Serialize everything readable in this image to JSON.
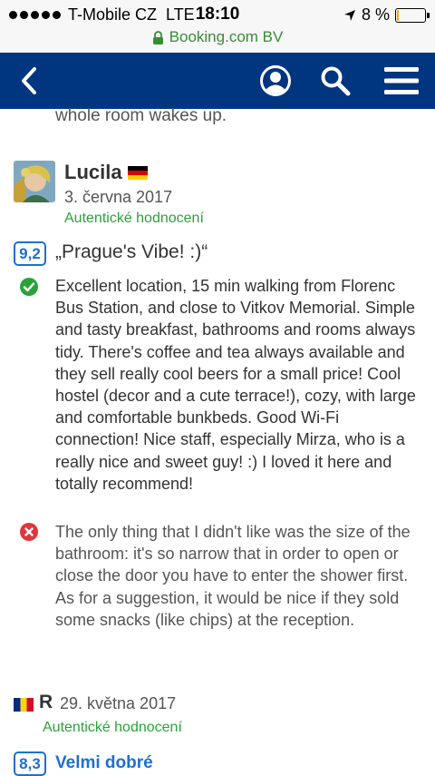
{
  "status_bar": {
    "carrier": "T-Mobile CZ",
    "network": "LTE",
    "time": "18:10",
    "battery_text": "8 %",
    "battery_fraction": 0.08,
    "battery_color": "#f5a800"
  },
  "url_bar": {
    "domain": "Booking.com BV",
    "lock_icon": "lock-icon"
  },
  "nav": {
    "background": "#003580",
    "icons": [
      "back-arrow-icon",
      "account-icon",
      "search-icon",
      "menu-icon"
    ]
  },
  "previous_review_tail": "whole room wakes up.",
  "review1": {
    "reviewer": "Lucila",
    "country_flag": "flag-germany-icon",
    "date": "3. června 2017",
    "verified": "Autentické hodnocení",
    "score": "9,2",
    "title": "„Prague's Vibe! :)“",
    "positive_icon": "check-circle-icon",
    "positive": "Excellent location, 15 min walking from Florenc Bus Station, and close to Vitkov Memorial. Simple and tasty breakfast, bathrooms and rooms always tidy. There's coffee and tea always available and they sell really cool beers for a small price! Cool hostel (decor and a cute terrace!), cozy, with large and comfortable bunkbeds. Good Wi-Fi connection! Nice staff, especially Mirza, who is a really nice and sweet guy! :) I loved it here and totally recommend!",
    "negative_icon": "x-circle-icon",
    "negative": "The only thing that I didn't like was the size of the bathroom: it's so narrow that in order to open or close the door you have to enter the shower first. As for a suggestion, it would be nice if they sold some snacks (like chips) at the reception."
  },
  "review2": {
    "reviewer": "R",
    "country_flag": "flag-romania-icon",
    "date": "29. května 2017",
    "verified": "Autentické hodnocení",
    "score": "8,3",
    "title": "Velmi dobré"
  },
  "colors": {
    "score_blue": "#1e6fd1",
    "verified_green": "#2ba13b",
    "positive_green": "#2ba13b",
    "negative_red": "#e0353a"
  }
}
